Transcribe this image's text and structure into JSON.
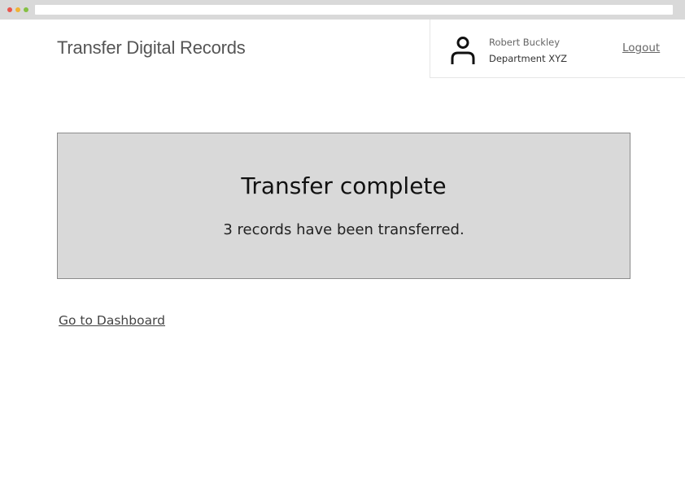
{
  "header": {
    "app_title": "Transfer Digital Records"
  },
  "user": {
    "name": "Robert Buckley",
    "department": "Department XYZ",
    "avatar_icon": "user-icon",
    "logout_label": "Logout"
  },
  "confirmation": {
    "title": "Transfer complete",
    "message": "3 records have been transferred."
  },
  "navigation": {
    "dashboard_link": "Go to Dashboard"
  },
  "colors": {
    "panel_background": "#d9d9d9",
    "panel_border": "#8c8c8c",
    "chrome": "#d9d9d9"
  }
}
